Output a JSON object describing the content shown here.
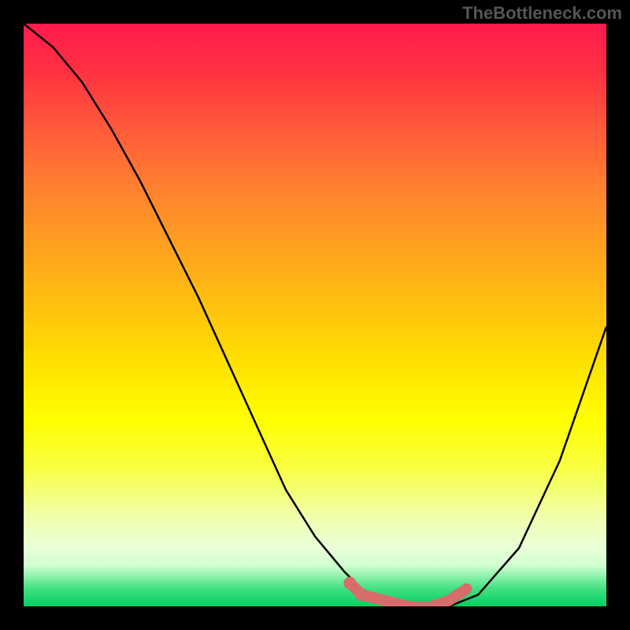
{
  "watermark": "TheBottleneck.com",
  "chart_data": {
    "type": "line",
    "title": "",
    "xlabel": "",
    "ylabel": "",
    "xlim": [
      0,
      100
    ],
    "ylim": [
      0,
      100
    ],
    "series": [
      {
        "name": "bottleneck-curve",
        "x": [
          0,
          5,
          10,
          15,
          20,
          25,
          30,
          35,
          40,
          45,
          50,
          55,
          58,
          62,
          66,
          70,
          73,
          78,
          85,
          92,
          100
        ],
        "y": [
          100,
          96,
          90,
          82,
          73,
          63,
          53,
          42,
          31,
          20,
          12,
          6,
          3,
          1,
          0,
          0,
          0,
          2,
          10,
          25,
          48
        ],
        "color": "#000000"
      },
      {
        "name": "highlight-band",
        "x": [
          56,
          58,
          62,
          66,
          70,
          73,
          76
        ],
        "y": [
          4,
          2,
          1,
          0,
          0,
          1,
          3
        ],
        "color": "#d86b6b"
      }
    ],
    "annotations": []
  }
}
